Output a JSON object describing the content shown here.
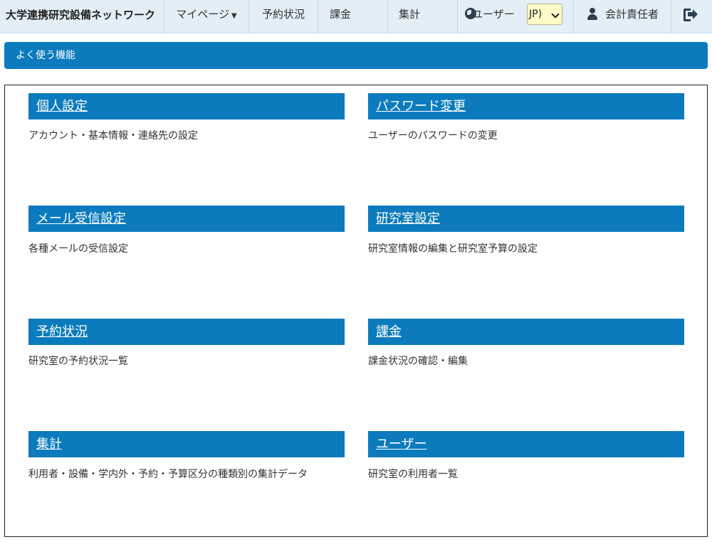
{
  "nav": {
    "brand": "大学連携研究設備ネットワーク",
    "mypage": "マイページ",
    "mypage_caret": "▼",
    "reservation_status": "予約状況",
    "billing": "課金",
    "summary": "集計",
    "users": "ユーザー",
    "language_value": "JP)",
    "account_role": "会計責任者"
  },
  "section": {
    "title": "よく使う機能"
  },
  "cards": [
    {
      "title": "個人設定",
      "desc": "アカウント・基本情報・連絡先の設定"
    },
    {
      "title": "パスワード変更",
      "desc": "ユーザーのパスワードの変更"
    },
    {
      "title": "メール受信設定",
      "desc": "各種メールの受信設定"
    },
    {
      "title": "研究室設定",
      "desc": "研究室情報の編集と研究室予算の設定"
    },
    {
      "title": "予約状況",
      "desc": "研究室の予約状況一覧"
    },
    {
      "title": "課金",
      "desc": "課金状況の確認・編集"
    },
    {
      "title": "集計",
      "desc": "利用者・設備・学内外・予約・予算区分の種類別の集計データ"
    },
    {
      "title": "ユーザー",
      "desc": "研究室の利用者一覧"
    }
  ],
  "colors": {
    "accent": "#0b7bbd",
    "nav_bg": "#e3eef7",
    "select_bg": "#fdfbc7"
  }
}
